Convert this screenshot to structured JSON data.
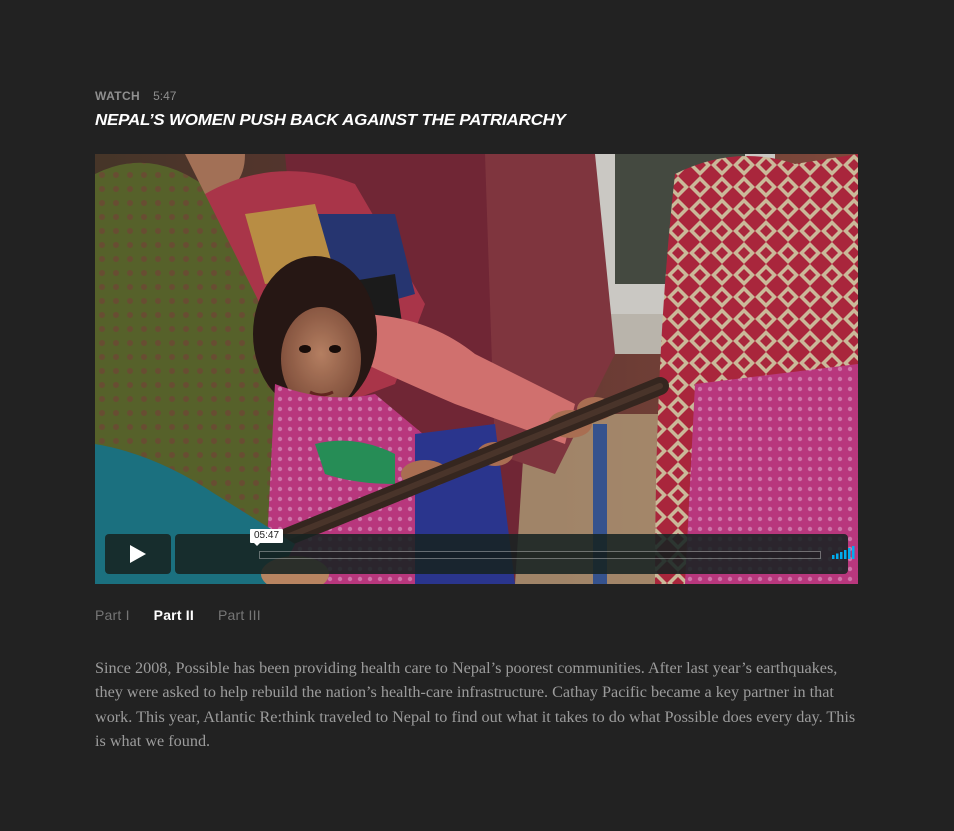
{
  "header": {
    "watch_label": "WATCH",
    "duration": "5:47",
    "title": "NEPAL’S WOMEN PUSH BACK AGAINST THE PATRIARCHY"
  },
  "player": {
    "timecode": "05:47",
    "progress": 0,
    "accent_color": "#00adef",
    "icons": [
      "play-icon",
      "volume-icon",
      "gear-icon",
      "fullscreen-icon"
    ]
  },
  "tabs": [
    {
      "label": "Part I",
      "active": false
    },
    {
      "label": "Part II",
      "active": true
    },
    {
      "label": "Part III",
      "active": false
    }
  ],
  "description": "Since 2008, Possible has been providing health care to Nepal’s poorest communities. After last year’s earthquakes, they were asked to help rebuild the nation’s health-care infrastructure. Cathay Pacific became a key partner in that work. This year, Atlantic Re:think traveled to Nepal to find out what it takes to do what Possible does every day. This is what we found."
}
